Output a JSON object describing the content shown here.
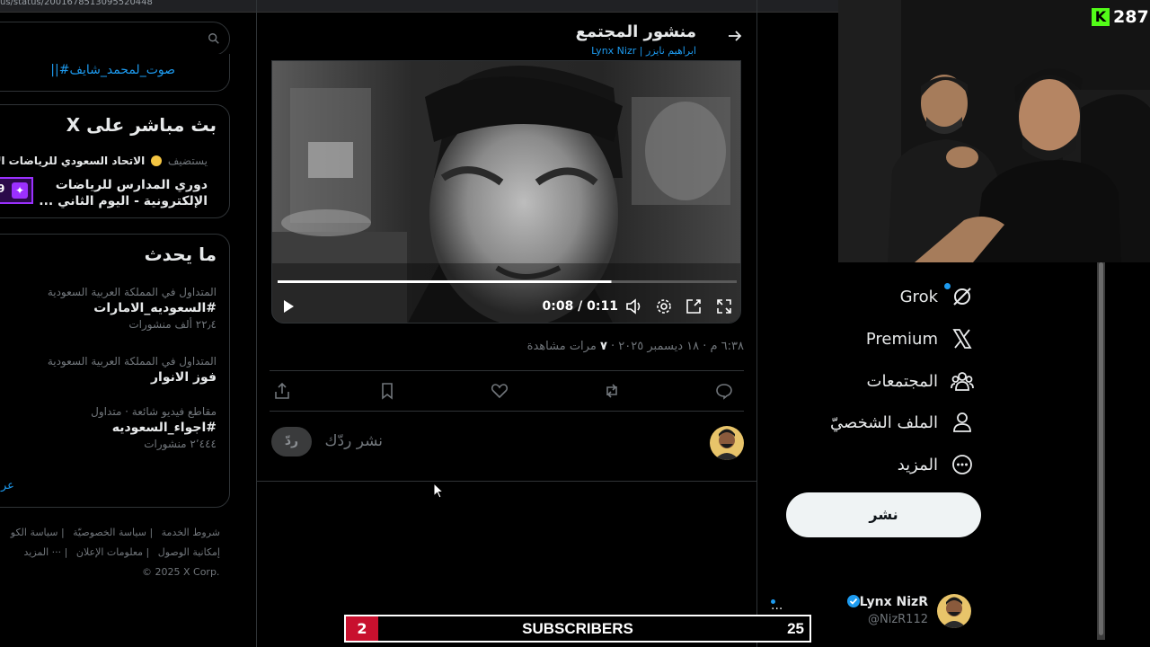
{
  "browser": {
    "url_fragment": "us/status/2001678513095520448"
  },
  "sidebar_right": {
    "search_placeholder": "",
    "hashtag_line": "||#صوت_لمحمد_شايف",
    "live": {
      "heading": "بث مباشر على X",
      "host_prefix": "يستضيف",
      "host_name": "الاتحاد السعودي للرياضات الإلك",
      "title": "دوري المدارس للرياضات الإلكترونية - اليوم الثاني ...",
      "badge_count": "9"
    },
    "trending": {
      "heading": "ما يحدث",
      "items": [
        {
          "context": "المتداول في المملكة العربية السعودية",
          "name": "#السعوديه_الامارات",
          "count": "٢٢٫٤ ألف منشورات"
        },
        {
          "context": "المتداول في المملكة العربية السعودية",
          "name": "فوز الانوار",
          "count": ""
        },
        {
          "context": "مقاطع فيديو شائعة · متداول",
          "name": "#اجواء_السعوديه",
          "count": "٢٬٤٤٤ منشورات"
        }
      ],
      "show_more": "عر"
    },
    "footer": {
      "row1": [
        "شروط الخدمة",
        "سياسة الخصوصيّة",
        "سياسة الكو"
      ],
      "row2": [
        "إمكانية الوصول",
        "معلومات الإعلان",
        "··· المزيد"
      ],
      "copyright": "© 2025 X Corp."
    }
  },
  "post": {
    "header_title": "منشور المجتمع",
    "header_sub": "Lynx Nizr | ابراهيم نايزر",
    "video": {
      "time": "0:08 / 0:11",
      "progress": 0.727
    },
    "meta": {
      "time": "٦:٣٨ م · ١٨ ديسمبر ٢٠٢٥",
      "views_count": "٧",
      "views_label": "مرات مشاهدة"
    },
    "reply_placeholder": "نشر ردّك",
    "reply_button": "ردّ"
  },
  "nav": {
    "items": [
      {
        "label": "Grok",
        "icon": "grok-icon"
      },
      {
        "label": "Premium",
        "icon": "x-logo-icon"
      },
      {
        "label": "المجتمعات",
        "icon": "communities-icon"
      },
      {
        "label": "الملف الشخصيّ",
        "icon": "profile-icon"
      },
      {
        "label": "المزيد",
        "icon": "more-circle-icon"
      }
    ],
    "post_button": "نشر"
  },
  "account": {
    "name": "Lynx NizR",
    "handle": "@NizR112",
    "more": "..."
  },
  "stream": {
    "kick_viewers": "287",
    "subscribers": {
      "left": "2",
      "label": "SUBSCRIBERS",
      "right": "25"
    }
  },
  "colors": {
    "accent": "#1d9bf0",
    "kick": "#53fc18",
    "sub_red": "#c8102e"
  }
}
